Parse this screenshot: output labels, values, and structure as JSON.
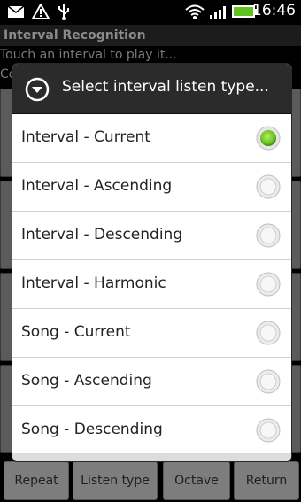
{
  "status_bar": {
    "time": "16:46",
    "icons": [
      "mail-icon",
      "alert-icon",
      "usb-icon",
      "wifi-icon",
      "signal-icon",
      "battery-icon"
    ]
  },
  "app": {
    "title": "Interval Recognition",
    "subtitle": "Touch an interval to play it...",
    "subtitle2": "Co"
  },
  "dialog": {
    "title": "Select interval listen type...",
    "options": [
      {
        "label": "Interval - Current",
        "selected": true
      },
      {
        "label": "Interval - Ascending",
        "selected": false
      },
      {
        "label": "Interval - Descending",
        "selected": false
      },
      {
        "label": "Interval - Harmonic",
        "selected": false
      },
      {
        "label": "Song - Current",
        "selected": false
      },
      {
        "label": "Song - Ascending",
        "selected": false
      },
      {
        "label": "Song - Descending",
        "selected": false
      }
    ]
  },
  "bottom_buttons": {
    "repeat": "Repeat",
    "listen_type": "Listen type",
    "octave": "Octave",
    "return": "Return"
  },
  "colors": {
    "selected_radio": "#6cc31c",
    "dialog_header": "#2b2b2b",
    "battery": "#5fc21f"
  }
}
